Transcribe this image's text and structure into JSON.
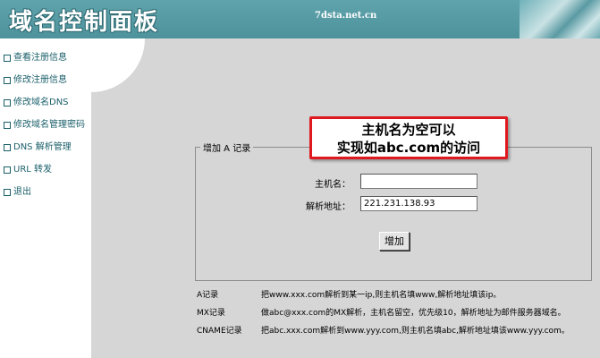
{
  "header": {
    "title": "域名控制面板",
    "site": "7dsta.net.cn"
  },
  "sidebar": {
    "items": [
      {
        "label": "查看注册信息"
      },
      {
        "label": "修改注册信息"
      },
      {
        "label": "修改域名DNS"
      },
      {
        "label": "修改域名管理密码"
      },
      {
        "label": "DNS 解析管理"
      },
      {
        "label": "URL 转发"
      },
      {
        "label": "退出"
      }
    ]
  },
  "form": {
    "legend": "增加 A 记录",
    "host_label": "主机名：",
    "host_value": "",
    "addr_label": "解析地址：",
    "addr_value": "221.231.138.93",
    "add_button": "增加"
  },
  "callout": {
    "line1": "主机名为空可以",
    "line2": "实现如abc.com的访问"
  },
  "notes": [
    {
      "type": "A记录",
      "desc": "把www.xxx.com解析到某一ip,则主机名填www,解析地址填该ip。"
    },
    {
      "type": "MX记录",
      "desc": "做abc@xxx.com的MX解析，主机名留空，优先级10，解析地址为邮件服务器域名。"
    },
    {
      "type": "CNAME记录",
      "desc": "把abc.xxx.com解析到www.yyy.com,则主机名填abc,解析地址填该www.yyy.com。"
    }
  ]
}
